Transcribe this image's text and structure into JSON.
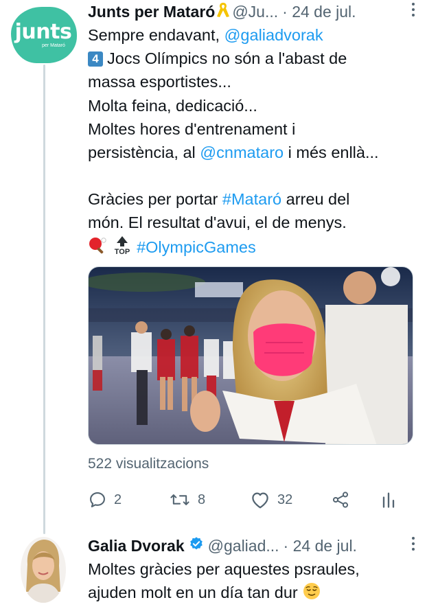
{
  "tweet1": {
    "avatar": {
      "logo_word": "junts",
      "logo_sub": "per Mataró",
      "color": "#3fc1a3"
    },
    "author": "Junts per Mataró",
    "author_emoji": "ribbon-icon",
    "handle": "@Ju...",
    "date": "· 24 de jul.",
    "body": {
      "l1_text": "Sempre endavant, ",
      "l1_mention": "@galiadvorak",
      "l2_keycap": "4",
      "l2_text": "Jocs Olímpics no són a l'abast de",
      "l3": "massa esportistes...",
      "l4": "Molta feina, dedicació...",
      "l5": "Moltes hores d'entrenament i",
      "l6_text": "persistència, al ",
      "l6_mention": "@cnmataro",
      "l6_text2": " i més enllà...",
      "l7_text": "Gràcies per portar ",
      "l7_hashtag": "#Mataró",
      "l7_text2": " arreu del",
      "l8": "món. El resultat d'avui, el de menys.",
      "l9_hashtag": "#OlympicGames",
      "l9_top_label": "TOP"
    },
    "views": "522 visualitzacions",
    "actions": {
      "replies": "2",
      "retweets": "8",
      "likes": "32"
    }
  },
  "tweet2": {
    "author": "Galia Dvorak",
    "handle": "@galiad...",
    "date": "· 24 de jul.",
    "body": {
      "l1": "Moltes gràcies per aquestes psraules,",
      "l2": "ajuden molt en un día tan dur"
    }
  },
  "colors": {
    "link": "#1d9bf0",
    "secondary_text": "#536471",
    "thread_line": "#cfd9de",
    "verified": "#1d9bf0"
  }
}
